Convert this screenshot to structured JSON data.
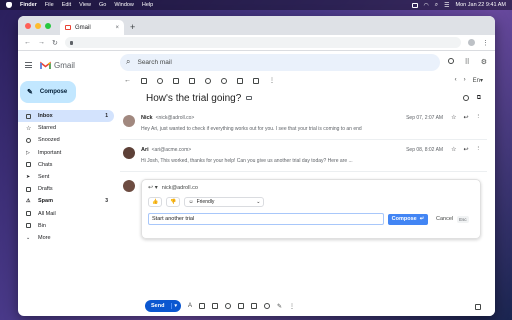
{
  "menubar": {
    "app": "Finder",
    "menus": [
      "File",
      "Edit",
      "View",
      "Go",
      "Window",
      "Help"
    ],
    "datetime": "Mon Jan 22  9:41 AM"
  },
  "browser": {
    "tab_title": "Gmail",
    "tab_close": "×",
    "new_tab": "+"
  },
  "gmail": {
    "logo_text": "Gmail",
    "compose_label": "Compose",
    "search_placeholder": "Search mail",
    "nav": [
      {
        "label": "Inbox",
        "count": "1",
        "active": true,
        "icon": "inbox-icon"
      },
      {
        "label": "Starred",
        "count": "",
        "icon": "star-icon"
      },
      {
        "label": "Snoozed",
        "count": "",
        "icon": "clock-icon"
      },
      {
        "label": "Important",
        "count": "",
        "icon": "important-icon"
      },
      {
        "label": "Chats",
        "count": "",
        "icon": "chat-icon"
      },
      {
        "label": "Sent",
        "count": "",
        "icon": "send-icon"
      },
      {
        "label": "Drafts",
        "count": "",
        "icon": "draft-icon"
      },
      {
        "label": "Spam",
        "count": "3",
        "icon": "spam-icon"
      },
      {
        "label": "All Mail",
        "count": "",
        "icon": "all-mail-icon"
      },
      {
        "label": "Bin",
        "count": "",
        "icon": "trash-icon"
      },
      {
        "label": "More",
        "count": "",
        "icon": "chevron-down-icon"
      }
    ],
    "thread": {
      "subject": "How's the trial going?",
      "messages": [
        {
          "sender": "Nick",
          "email": "<nick@adroll.co>",
          "date": "Sep 07, 2:07 AM",
          "snippet": "Hey Ari, just wanted to check if everything works out for you. I see that your trial is coming to an end"
        },
        {
          "sender": "Ari",
          "email": "<ari@acme.com>",
          "date": "Sep 08, 8:02 AM",
          "snippet": "Hi Josh, This worked, thanks for your help! Can you give us another trial day today? Here are ..."
        }
      ]
    },
    "reply": {
      "to": "nick@adroll.co",
      "tone_label": "Friendly",
      "prompt_value": "Start another trial",
      "compose_label": "Compose",
      "cancel_label": "Cancel",
      "esc_label": "Esc",
      "send_label": "Send"
    }
  }
}
